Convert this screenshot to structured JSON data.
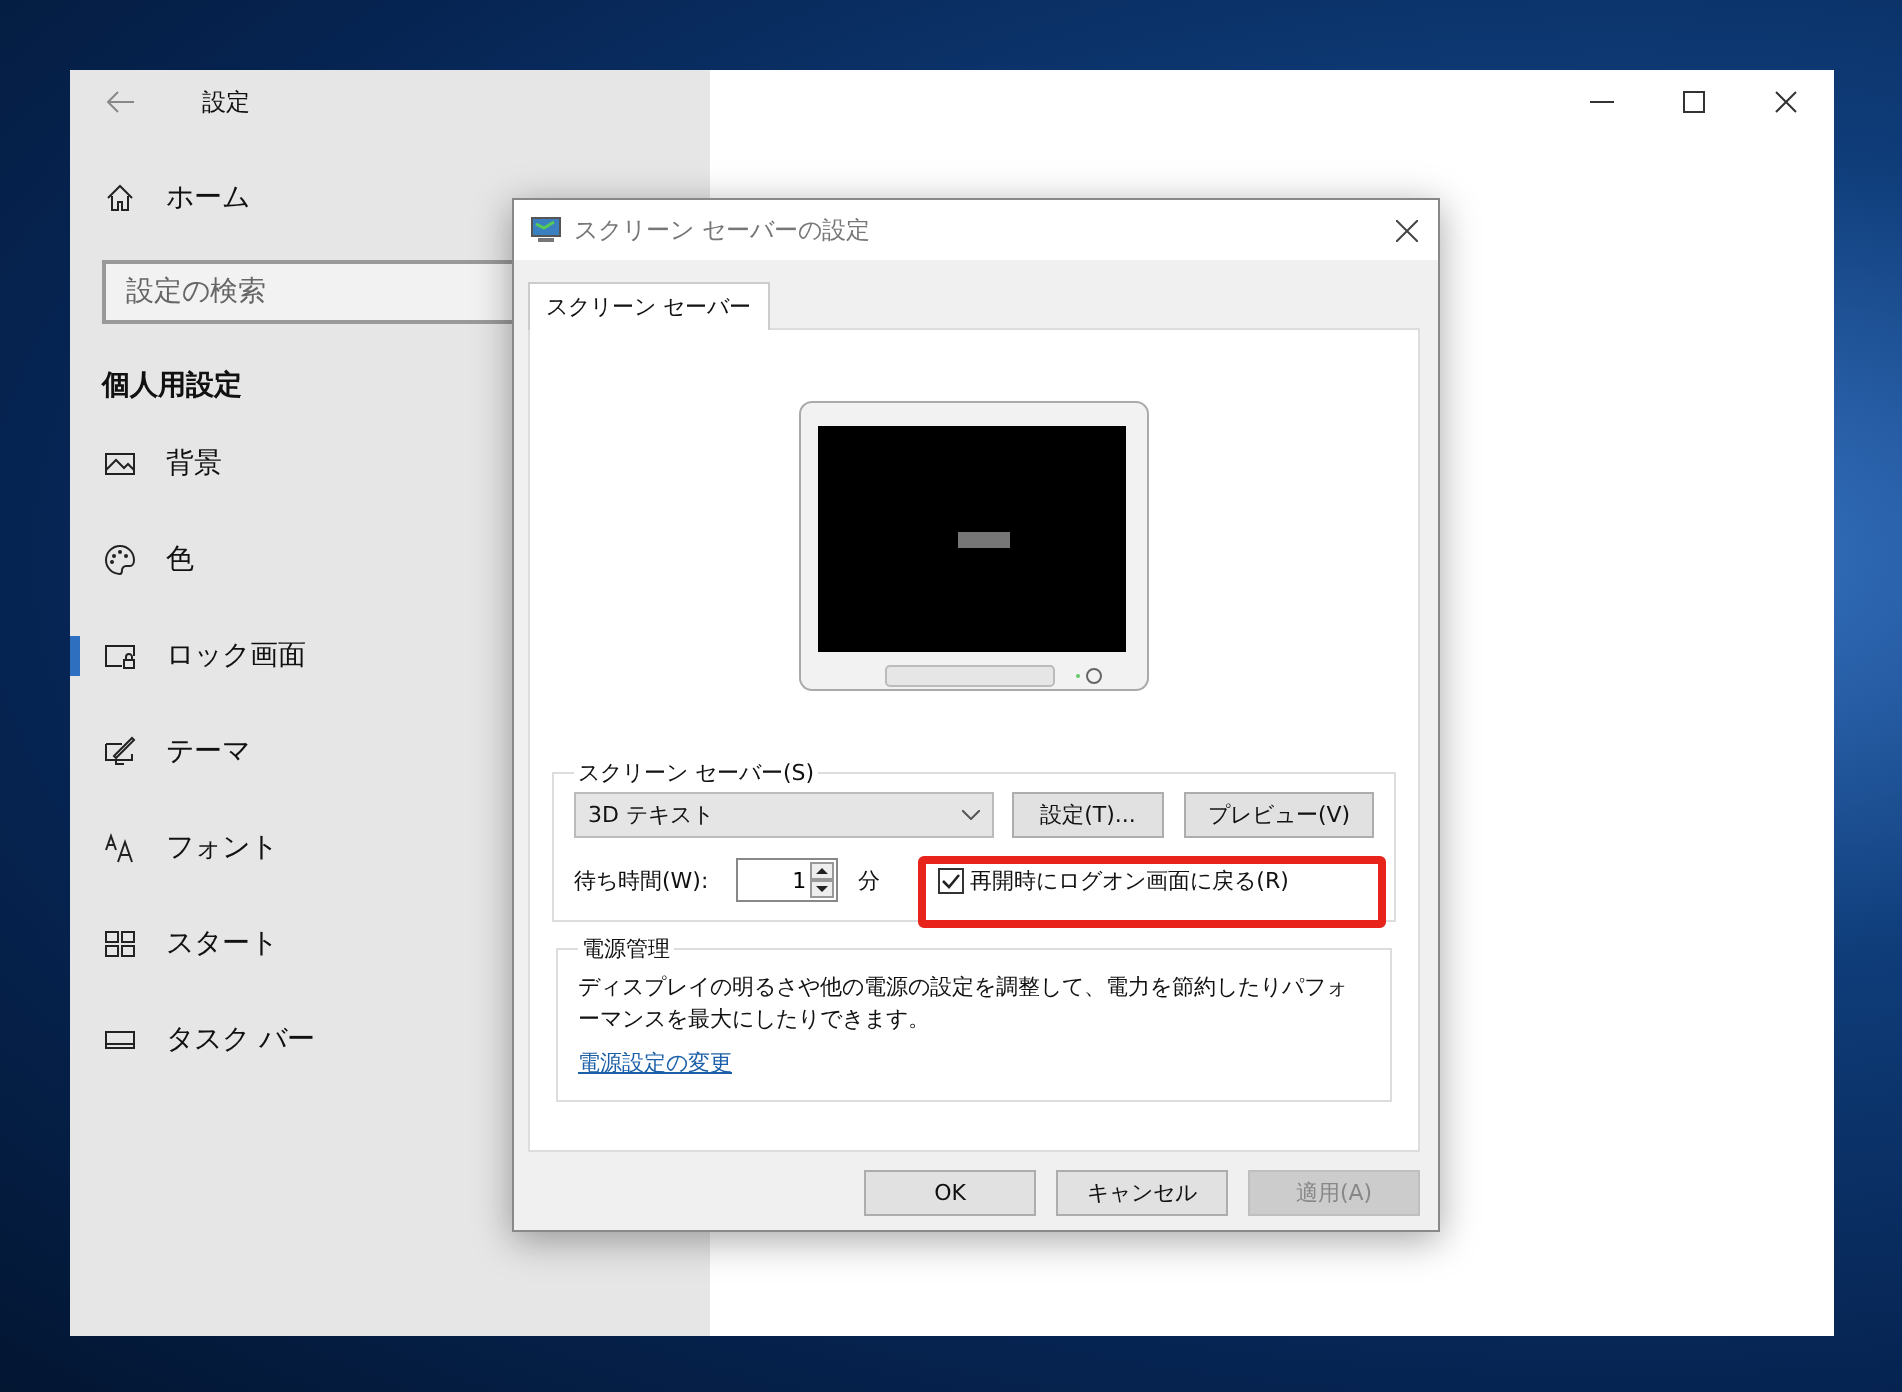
{
  "settings_window": {
    "title": "設定",
    "home": "ホーム",
    "search": {
      "placeholder": "設定の検索"
    },
    "section": "個人用設定",
    "items": [
      {
        "label": "背景",
        "kind": "image",
        "selected": false
      },
      {
        "label": "色",
        "kind": "palette",
        "selected": false
      },
      {
        "label": "ロック画面",
        "kind": "lock",
        "selected": true
      },
      {
        "label": "テーマ",
        "kind": "theme",
        "selected": false
      },
      {
        "label": "フォント",
        "kind": "font",
        "selected": false
      },
      {
        "label": "スタート",
        "kind": "start",
        "selected": false
      },
      {
        "label": "タスク バー",
        "kind": "taskbar",
        "selected": false
      }
    ]
  },
  "dialog": {
    "title": "スクリーン セーバーの設定",
    "tabs": [
      {
        "label": "スクリーン セーバー",
        "selected": true
      }
    ],
    "screensaver_group": {
      "legend": "スクリーン セーバー(S)",
      "dropdown": "3D テキスト",
      "settings_button": "設定(T)...",
      "preview_button": "プレビュー(V)",
      "wait_label": "待ち時間(W):",
      "wait_value": "1",
      "wait_unit": "分",
      "logon_checkbox": {
        "label": "再開時にログオン画面に戻る(R)",
        "checked": true
      }
    },
    "power_group": {
      "legend": "電源管理",
      "description": "ディスプレイの明るさや他の電源の設定を調整して、電力を節約したりパフォーマンスを最大にしたりできます。",
      "link": "電源設定の変更"
    },
    "buttons": [
      {
        "label": "OK",
        "disabled": false
      },
      {
        "label": "キャンセル",
        "disabled": false
      },
      {
        "label": "適用(A)",
        "disabled": true
      }
    ]
  }
}
